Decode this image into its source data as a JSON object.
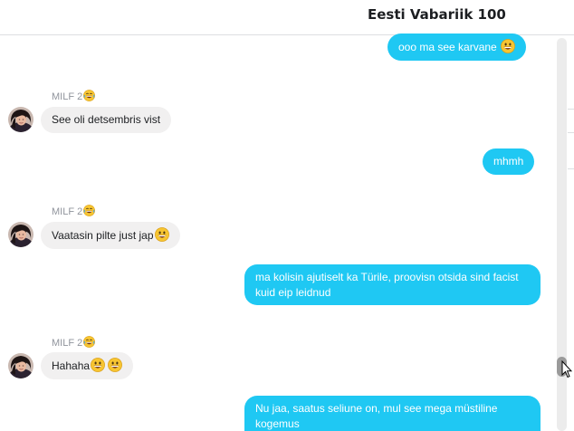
{
  "conversation": {
    "title": "Eesti Vabariik 100"
  },
  "messages": [
    {
      "text": "ooo ma see karvane",
      "emoji": [
        "grinning-emoji"
      ]
    },
    {
      "sender": "MILF 2",
      "sender_emoji": "laughing-emoji",
      "text": "See oli detsembris vist"
    },
    {
      "text": "mhmh"
    },
    {
      "sender": "MILF 2",
      "sender_emoji": "laughing-emoji",
      "text": "Vaatasin pilte just jap",
      "emoji": [
        "grinning-emoji"
      ]
    },
    {
      "text": "ma kolisin ajutiselt ka Türile, proovisn otsida sind facist kuid eip leidnud"
    },
    {
      "sender": "MILF 2",
      "sender_emoji": "laughing-emoji",
      "text": "Hahaha",
      "emoji": [
        "grinning-emoji",
        "grinning-emoji"
      ]
    },
    {
      "text": "Nu jaa, saatus seliune on, mul see mega müstiline kogemus"
    }
  ],
  "colors": {
    "outgoing": "#1fc8f3",
    "incoming": "#f1f0f0",
    "sender_name": "#90949c"
  }
}
